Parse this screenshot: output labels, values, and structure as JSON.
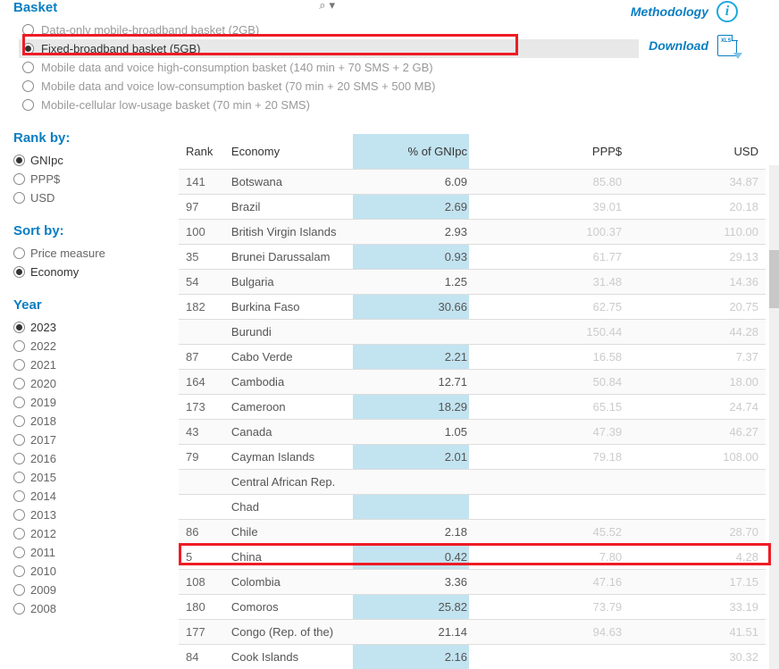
{
  "header": {
    "methodology": "Methodology",
    "download": "Download"
  },
  "search": {
    "icon_label": "⌕",
    "dropdown": "▾"
  },
  "basket": {
    "title": "Basket",
    "options": [
      "Data-only mobile-broadband basket (2GB)",
      "Fixed-broadband basket (5GB)",
      "Mobile data and voice high-consumption basket (140 min + 70 SMS + 2 GB)",
      "Mobile data and voice low-consumption basket (70 min + 20 SMS + 500 MB)",
      "Mobile-cellular low-usage basket (70 min + 20 SMS)"
    ],
    "selected_index": 1
  },
  "rank_by": {
    "title": "Rank by:",
    "options": [
      "GNIpc",
      "PPP$",
      "USD"
    ],
    "selected_index": 0
  },
  "sort_by": {
    "title": "Sort by:",
    "options": [
      "Price measure",
      "Economy"
    ],
    "selected_index": 1
  },
  "year": {
    "title": "Year",
    "options": [
      "2023",
      "2022",
      "2021",
      "2020",
      "2019",
      "2018",
      "2017",
      "2016",
      "2015",
      "2014",
      "2013",
      "2012",
      "2011",
      "2010",
      "2009",
      "2008"
    ],
    "selected_index": 0
  },
  "table": {
    "headers": {
      "rank": "Rank",
      "economy": "Economy",
      "gni": "% of GNIpc",
      "ppp": "PPP$",
      "usd": "USD"
    },
    "rows": [
      {
        "rank": "141",
        "economy": "Botswana",
        "gni": "6.09",
        "ppp": "85.80",
        "usd": "34.87"
      },
      {
        "rank": "97",
        "economy": "Brazil",
        "gni": "2.69",
        "ppp": "39.01",
        "usd": "20.18"
      },
      {
        "rank": "100",
        "economy": "British Virgin Islands",
        "gni": "2.93",
        "ppp": "100.37",
        "usd": "110.00"
      },
      {
        "rank": "35",
        "economy": "Brunei Darussalam",
        "gni": "0.93",
        "ppp": "61.77",
        "usd": "29.13"
      },
      {
        "rank": "54",
        "economy": "Bulgaria",
        "gni": "1.25",
        "ppp": "31.48",
        "usd": "14.36"
      },
      {
        "rank": "182",
        "economy": "Burkina Faso",
        "gni": "30.66",
        "ppp": "62.75",
        "usd": "20.75"
      },
      {
        "rank": "",
        "economy": "Burundi",
        "gni": "",
        "ppp": "150.44",
        "usd": "44.28"
      },
      {
        "rank": "87",
        "economy": "Cabo Verde",
        "gni": "2.21",
        "ppp": "16.58",
        "usd": "7.37"
      },
      {
        "rank": "164",
        "economy": "Cambodia",
        "gni": "12.71",
        "ppp": "50.84",
        "usd": "18.00"
      },
      {
        "rank": "173",
        "economy": "Cameroon",
        "gni": "18.29",
        "ppp": "65.15",
        "usd": "24.74"
      },
      {
        "rank": "43",
        "economy": "Canada",
        "gni": "1.05",
        "ppp": "47.39",
        "usd": "46.27"
      },
      {
        "rank": "79",
        "economy": "Cayman Islands",
        "gni": "2.01",
        "ppp": "79.18",
        "usd": "108.00"
      },
      {
        "rank": "",
        "economy": "Central African Rep.",
        "gni": "",
        "ppp": "",
        "usd": ""
      },
      {
        "rank": "",
        "economy": "Chad",
        "gni": "",
        "ppp": "",
        "usd": ""
      },
      {
        "rank": "86",
        "economy": "Chile",
        "gni": "2.18",
        "ppp": "45.52",
        "usd": "28.70"
      },
      {
        "rank": "5",
        "economy": "China",
        "gni": "0.42",
        "ppp": "7.80",
        "usd": "4.28"
      },
      {
        "rank": "108",
        "economy": "Colombia",
        "gni": "3.36",
        "ppp": "47.16",
        "usd": "17.15"
      },
      {
        "rank": "180",
        "economy": "Comoros",
        "gni": "25.82",
        "ppp": "73.79",
        "usd": "33.19"
      },
      {
        "rank": "177",
        "economy": "Congo (Rep. of the)",
        "gni": "21.14",
        "ppp": "94.63",
        "usd": "41.51"
      },
      {
        "rank": "84",
        "economy": "Cook Islands",
        "gni": "2.16",
        "ppp": "",
        "usd": "30.32"
      }
    ],
    "highlighted_row_index": 15
  }
}
